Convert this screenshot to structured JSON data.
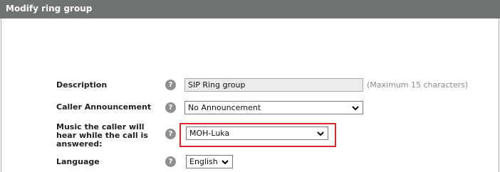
{
  "window": {
    "title": "Modify ring group"
  },
  "form": {
    "description": {
      "label": "Description",
      "value": "SIP Ring group",
      "hint": "(Maximum 15 characters)"
    },
    "caller_announcement": {
      "label": "Caller Announcement",
      "selected": "No Announcement"
    },
    "music_on_hold": {
      "label_lines": [
        "Music the caller will",
        "hear while the call is",
        "answered:"
      ],
      "selected": "MOH-Luka"
    },
    "language": {
      "label": "Language",
      "selected": "English"
    },
    "help_glyph": "?"
  },
  "icons": {
    "help": "help-icon",
    "dropdown": "chevron-down-icon"
  },
  "colors": {
    "titlebar": "#6e7273",
    "highlight": "#d7282f",
    "help_icon": "#8f8f8f"
  }
}
